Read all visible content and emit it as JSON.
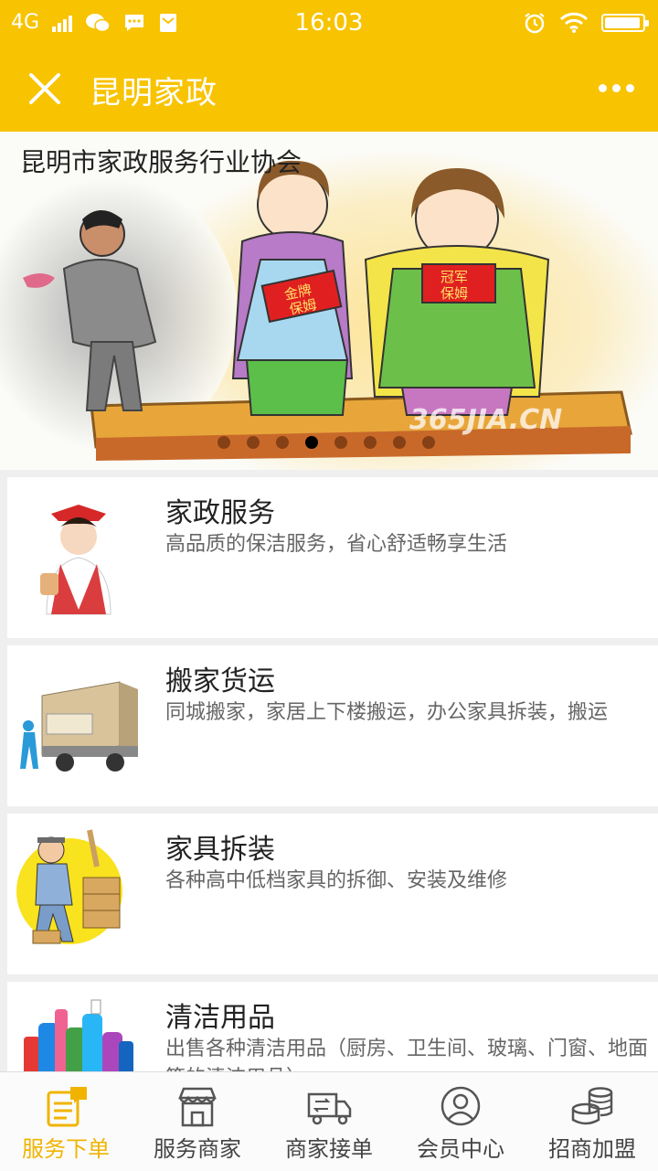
{
  "status_bar": {
    "network": "4G",
    "time": "16:03"
  },
  "nav": {
    "title": "昆明家政",
    "close_icon": "close-icon",
    "more_icon": "more-icon"
  },
  "banner": {
    "caption": "昆明市家政服务行业协会",
    "sign_left": [
      "金牌",
      "保姆"
    ],
    "sign_right": [
      "冠军",
      "保姆"
    ],
    "watermark": "365JIA.CN",
    "slide_count": 8,
    "active_slide": 3
  },
  "services": [
    {
      "title": "家政服务",
      "desc": "高品质的保洁服务，省心舒适畅享生活",
      "icon": "housekeeper-icon"
    },
    {
      "title": "搬家货运",
      "desc": "同城搬家，家居上下楼搬运，办公家具拆装，搬运",
      "icon": "moving-truck-icon"
    },
    {
      "title": "家具拆装",
      "desc": "各种高中低档家具的拆御、安装及维修",
      "icon": "carpenter-icon"
    },
    {
      "title": "清洁用品",
      "desc": "出售各种清洁用品（厨房、卫生间、玻璃、门窗、地面等的清洁用品）",
      "icon": "cleaning-bottles-icon"
    }
  ],
  "tabs": [
    {
      "label": "服务下单",
      "icon": "order-icon",
      "active": true
    },
    {
      "label": "服务商家",
      "icon": "shop-icon",
      "active": false
    },
    {
      "label": "商家接单",
      "icon": "truck-icon",
      "active": false
    },
    {
      "label": "会员中心",
      "icon": "user-icon",
      "active": false
    },
    {
      "label": "招商加盟",
      "icon": "coins-icon",
      "active": false
    }
  ],
  "colors": {
    "brand": "#f8c300",
    "tab_active": "#f0b400",
    "text": "#222222",
    "desc": "#666666"
  }
}
